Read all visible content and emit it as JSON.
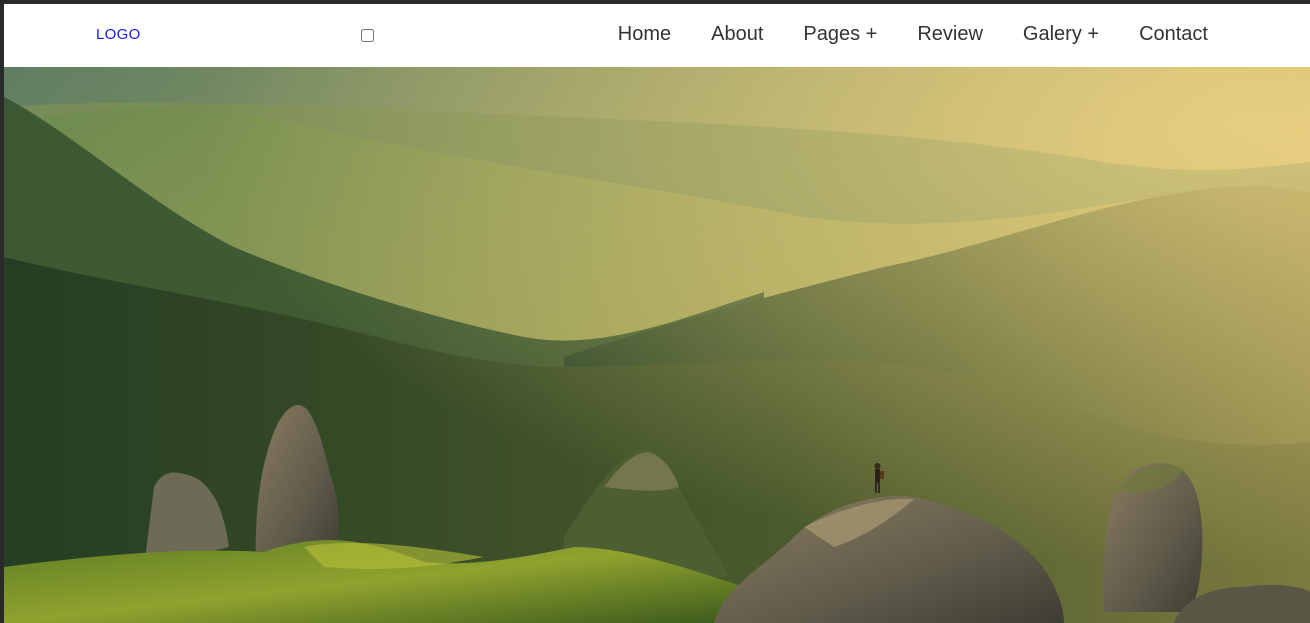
{
  "header": {
    "logo_text": "LOGO",
    "nav": [
      {
        "label": "Home"
      },
      {
        "label": "About"
      },
      {
        "label": "Pages +"
      },
      {
        "label": "Review"
      },
      {
        "label": "Galery +"
      },
      {
        "label": "Contact"
      }
    ]
  },
  "hero": {
    "image": "mountain-landscape-with-hiker-on-rock"
  },
  "colors": {
    "logo": "#1a1ae6",
    "nav_text": "#333333",
    "navbar_bg": "#ffffff"
  }
}
